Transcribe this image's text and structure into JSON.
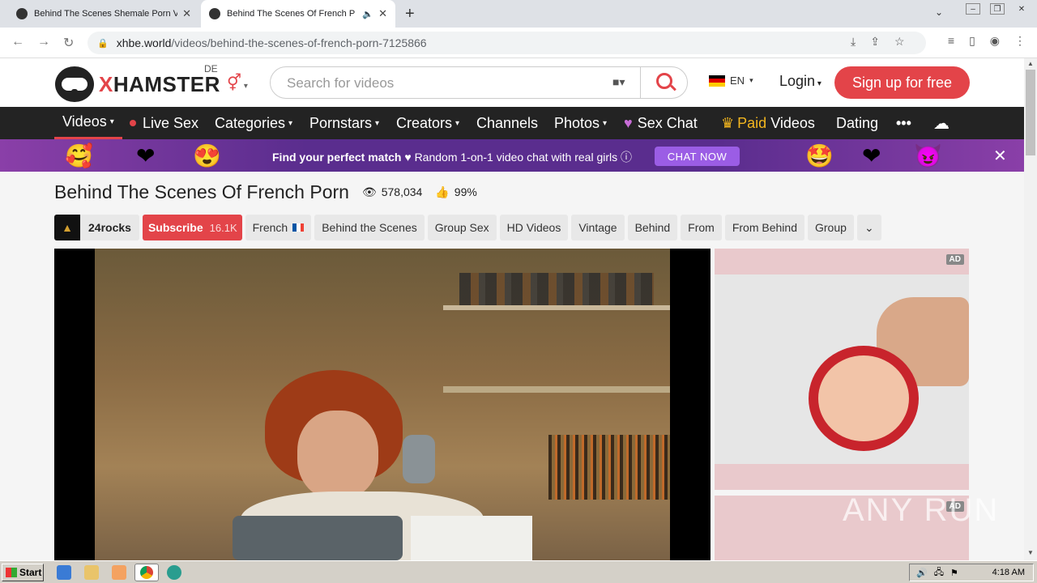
{
  "browser": {
    "tabs": [
      {
        "title": "Behind The Scenes Shemale Porn Vic",
        "active": false
      },
      {
        "title": "Behind The Scenes Of French P",
        "active": true
      }
    ],
    "new_tab_glyph": "+",
    "url_host": "xhbe.world",
    "url_path": "/videos/behind-the-scenes-of-french-porn-7125866"
  },
  "site": {
    "brand_x": "X",
    "brand_rest": "HAMSTER",
    "country_code": "DE",
    "search_placeholder": "Search for videos",
    "lang_label": "EN",
    "login_label": "Login",
    "signup_label": "Sign up for free",
    "nav": [
      {
        "label": "Videos"
      },
      {
        "label": "Live Sex"
      },
      {
        "label": "Categories"
      },
      {
        "label": "Pornstars"
      },
      {
        "label": "Creators"
      },
      {
        "label": "Channels"
      },
      {
        "label": "Photos"
      },
      {
        "label": "Sex Chat"
      },
      {
        "label_gold": "Paid",
        "label": "Videos"
      },
      {
        "label": "Dating"
      },
      {
        "label": "•••"
      }
    ],
    "promo": {
      "bold": "Find your perfect match",
      "rest": "Random 1-on-1 video chat with real girls",
      "cta": "CHAT NOW"
    }
  },
  "video": {
    "title": "Behind The Scenes Of French Porn",
    "views": "578,034",
    "rating": "99%",
    "channel_name": "24rocks",
    "subscribe_label": "Subscribe",
    "subscriber_count": "16.1K",
    "tags": [
      "French",
      "Behind the Scenes",
      "Group Sex",
      "HD Videos",
      "Vintage",
      "Behind",
      "From",
      "From Behind",
      "Group"
    ]
  },
  "ads": {
    "label": "AD"
  },
  "watermark": "ANY RUN",
  "taskbar": {
    "start_label": "Start",
    "clock": "4:18 AM"
  }
}
